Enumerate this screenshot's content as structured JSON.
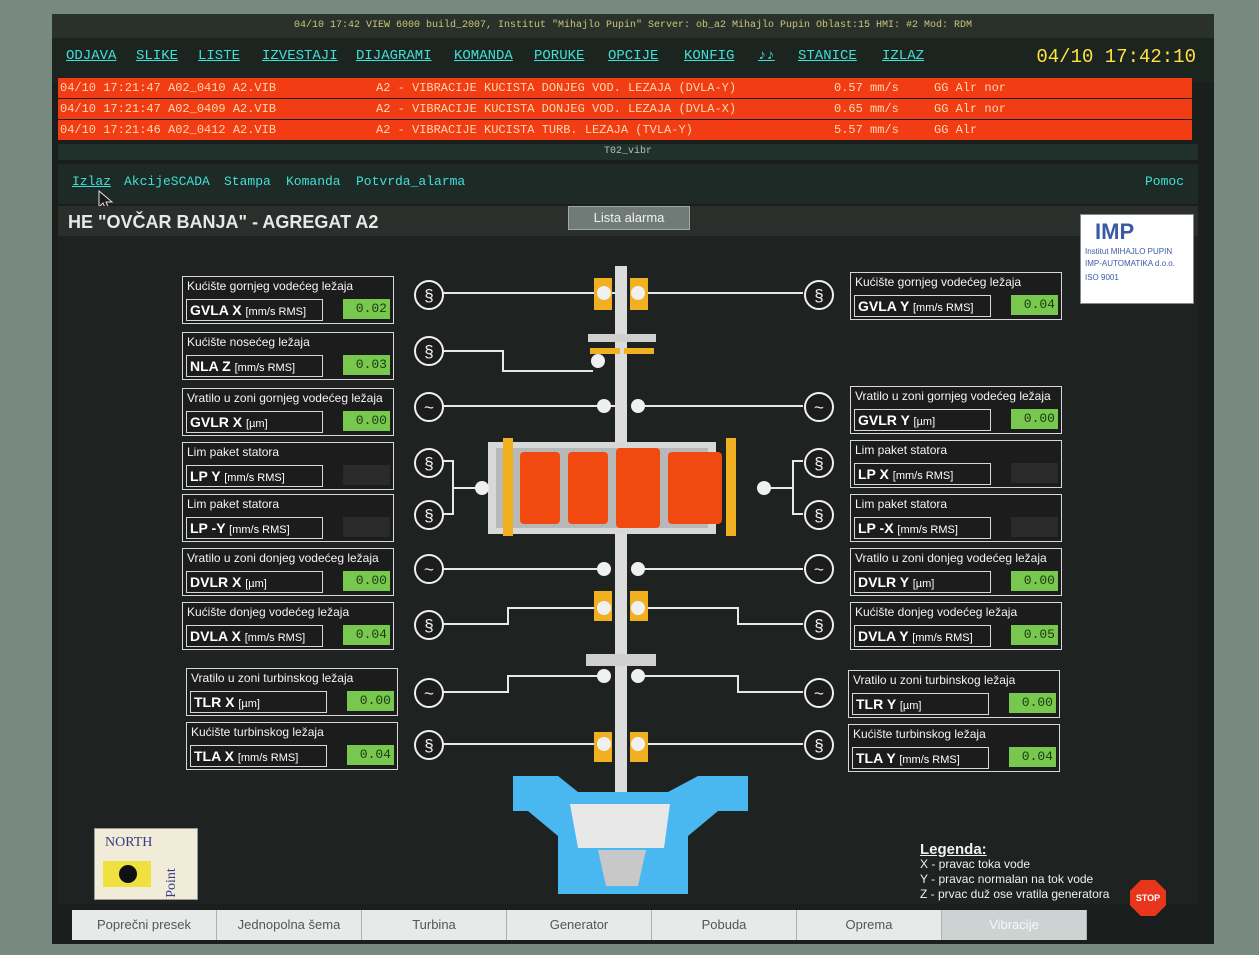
{
  "status_line": "04/10 17:42   VIEW 6000 build_2007, Institut \"Mihajlo Pupin\"   Server: ob_a2   Mihajlo Pupin   Oblast:15   HMI: #2   Mod: RDM",
  "menu": [
    "ODJAVA",
    "SLIKE",
    "LISTE",
    "IZVESTAJI",
    "DIJAGRAMI",
    "KOMANDA",
    "PORUKE",
    "OPCIJE",
    "KONFIG",
    "♪♪",
    "STANICE",
    "IZLAZ"
  ],
  "clock": "04/10 17:42:10",
  "alarms": [
    {
      "time": "04/10 17:21:47 A02_0410 A2.VIB",
      "text": "A2 - VIBRACIJE KUCISTA DONJEG VOD. LEZAJA (DVLA-Y)",
      "value": "0.57 mm/s",
      "status": "GG Alr nor"
    },
    {
      "time": "04/10 17:21:47 A02_0409 A2.VIB",
      "text": "A2 - VIBRACIJE KUCISTA DONJEG VOD. LEZAJA (DVLA-X)",
      "value": "0.65 mm/s",
      "status": "GG Alr nor"
    },
    {
      "time": "04/10 17:21:46 A02_0412 A2.VIB",
      "text": "A2 - VIBRACIJE KUCISTA TURB. LEZAJA (TVLA-Y)",
      "value": "5.57 mm/s",
      "status": "GG Alr"
    }
  ],
  "window_title": "T02_vibr",
  "toolbar": {
    "items": [
      "Izlaz",
      "AkcijeSCADA",
      "Stampa",
      "Komanda",
      "Potvrda_alarma"
    ],
    "help": "Pomoc"
  },
  "plant_title": "HE \"OVČAR BANJA\" - AGREGAT A2",
  "alarm_list_button": "Lista alarma",
  "logo": {
    "mark": "IMP",
    "line1": "Institut MIHAJLO PUPIN",
    "line2": "IMP-AUTOMATIKA d.o.o.",
    "line3": "ISO 9001"
  },
  "left_panels": [
    {
      "label": "Kućište gornjeg vodećeg ležaja",
      "code": "GVLA X",
      "unit": "[mm/s RMS]",
      "value": "0.02",
      "highlight": true
    },
    {
      "label": "Kućište nosećeg ležaja",
      "code": "NLA Z",
      "unit": "[mm/s RMS]",
      "value": "0.03",
      "highlight": true
    },
    {
      "label": "Vratilo u zoni gornjeg vodećeg ležaja",
      "code": "GVLR X",
      "unit": "[µm]",
      "value": "0.00",
      "highlight": true
    },
    {
      "label": "Lim paket statora",
      "code": "LP Y",
      "unit": "[mm/s RMS]",
      "value": "",
      "highlight": false
    },
    {
      "label": "Lim paket statora",
      "code": "LP -Y",
      "unit": "[mm/s RMS]",
      "value": "",
      "highlight": false
    },
    {
      "label": "Vratilo u zoni donjeg vodećeg ležaja",
      "code": "DVLR X",
      "unit": "[µm]",
      "value": "0.00",
      "highlight": true
    },
    {
      "label": "Kućište donjeg vodećeg ležaja",
      "code": "DVLA X",
      "unit": "[mm/s RMS]",
      "value": "0.04",
      "highlight": true
    },
    {
      "label": "Vratilo u zoni turbinskog ležaja",
      "code": "TLR X",
      "unit": "[µm]",
      "value": "0.00",
      "highlight": true
    },
    {
      "label": "Kućište turbinskog ležaja",
      "code": "TLA X",
      "unit": "[mm/s RMS]",
      "value": "0.04",
      "highlight": true
    }
  ],
  "right_panels": [
    {
      "label": "Kućište gornjeg vodećeg ležaja",
      "code": "GVLA Y",
      "unit": "[mm/s RMS]",
      "value": "0.04",
      "highlight": true
    },
    {
      "label": "Vratilo u zoni gornjeg vodećeg ležaja",
      "code": "GVLR Y",
      "unit": "[µm]",
      "value": "0.00",
      "highlight": true
    },
    {
      "label": "Lim paket statora",
      "code": "LP X",
      "unit": "[mm/s RMS]",
      "value": "",
      "highlight": false
    },
    {
      "label": "Lim paket statora",
      "code": "LP -X",
      "unit": "[mm/s RMS]",
      "value": "",
      "highlight": false
    },
    {
      "label": "Vratilo u zoni donjeg vodećeg ležaja",
      "code": "DVLR Y",
      "unit": "[µm]",
      "value": "0.00",
      "highlight": true
    },
    {
      "label": "Kućište donjeg vodećeg ležaja",
      "code": "DVLA Y",
      "unit": "[mm/s RMS]",
      "value": "0.05",
      "highlight": true
    },
    {
      "label": "Vratilo u zoni turbinskog ležaja",
      "code": "TLR Y",
      "unit": "[µm]",
      "value": "0.00",
      "highlight": true
    },
    {
      "label": "Kućište turbinskog ležaja",
      "code": "TLA Y",
      "unit": "[mm/s RMS]",
      "value": "0.04",
      "highlight": true
    }
  ],
  "northpoint_logo": {
    "line1": "NORTH",
    "line2": "Point"
  },
  "legend": {
    "title": "Legenda:",
    "lines": [
      "X - pravac toka vode",
      "Y - pravac normalan na tok vode",
      "Z - prvac duž ose vratila generatora"
    ]
  },
  "stop_label": "STOP",
  "tabs": [
    "Poprečni presek",
    "Jednopolna šema",
    "Turbina",
    "Generator",
    "Pobuda",
    "Oprema",
    "Vibracije"
  ],
  "active_tab": "Vibracije",
  "colors": {
    "alarm_bg": "#f23c14",
    "menu_text": "#3fe0d8",
    "clock": "#ffe040",
    "value_highlight": "#78c850",
    "rotor": "#f04a10",
    "bearing": "#f0b020",
    "water": "#4ab8f0"
  }
}
